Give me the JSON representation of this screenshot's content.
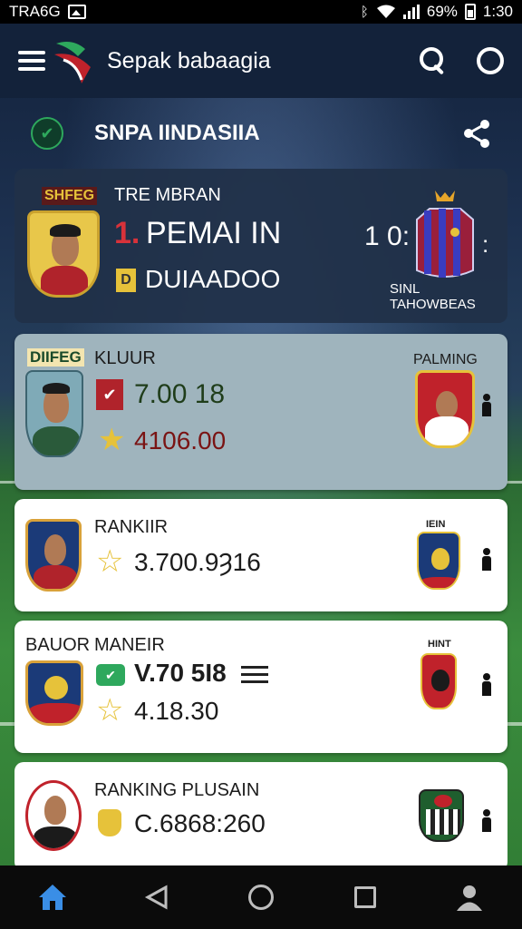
{
  "status_bar": {
    "carrier": "TRA6G",
    "battery_pct": "69%",
    "time": "1:30"
  },
  "app_bar": {
    "title": "Sepak babaagia"
  },
  "section": {
    "title": "SNPA IINDASIIA"
  },
  "cards": [
    {
      "tag": "SHFEG",
      "header": "TRE MBRAN",
      "rank": "1.",
      "name": "PEMAI IN",
      "sub": "DUIAADOO",
      "score": "1 0:",
      "score_suffix": ":",
      "opponent": "SINL TAHOWBEAS"
    },
    {
      "tag": "DIIFEG",
      "header": "KLUUR",
      "value1": "7.00 18",
      "value2": "4106.00",
      "opponent": "PALMING"
    },
    {
      "header": "RANKIIR",
      "value1": "3.700.9Ȝ16",
      "crest_label": "IEIN"
    },
    {
      "tag": "BAUOR",
      "header": "MANEIR",
      "value1": "V.70 5I8",
      "value2": "4.18.30",
      "crest_label": "HINT"
    },
    {
      "header": "RANKING PLUSAIN",
      "value1": "C.6868:260"
    }
  ],
  "colors": {
    "accent_blue": "#3a8ee6",
    "header_bg": "#13223a",
    "card_dark": "#203048",
    "card_teal": "#9fb4bd",
    "star_gold": "#e6c23a",
    "red": "#b0232b",
    "green": "#2ea85d"
  },
  "icons": [
    "menu-icon",
    "search-icon",
    "settings-ring-icon",
    "share-icon",
    "star-icon",
    "person-icon",
    "home-icon",
    "back-icon",
    "circle-home-icon",
    "square-recents-icon",
    "profile-icon"
  ]
}
